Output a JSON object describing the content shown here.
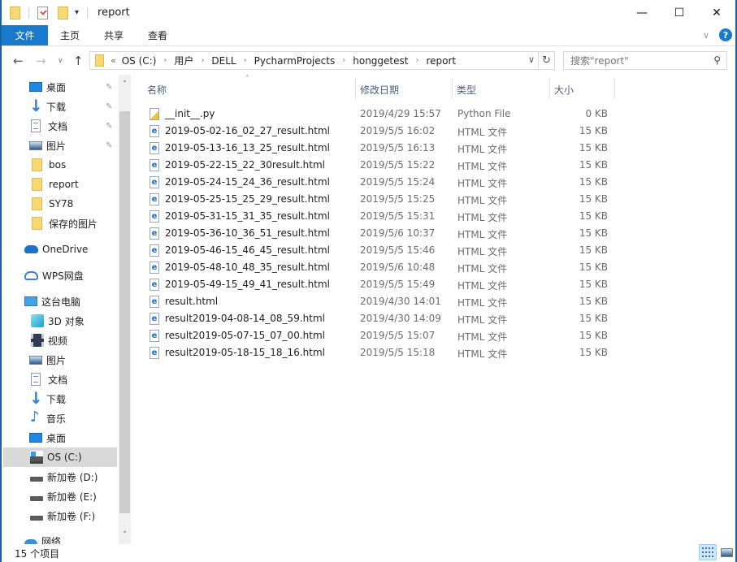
{
  "window": {
    "title": "report",
    "controls": {
      "minimize": "—",
      "maximize": "☐",
      "close": "✕"
    }
  },
  "ribbon": {
    "tabs": [
      {
        "label": "文件",
        "active": true
      },
      {
        "label": "主页"
      },
      {
        "label": "共享"
      },
      {
        "label": "查看"
      }
    ],
    "expand_icon": "∨",
    "help_icon": "?"
  },
  "nav": {
    "back": "←",
    "forward": "→",
    "recent": "∨",
    "up": "↑",
    "breadcrumb_lead": "«",
    "breadcrumb": [
      "OS (C:)",
      "用户",
      "DELL",
      "PycharmProjects",
      "honggetest",
      "report"
    ],
    "breadcrumb_sep": "›",
    "address_dropdown": "∨",
    "refresh": "↻",
    "search_placeholder": "搜索\"report\"",
    "search_icon": "⌕"
  },
  "sidebar": {
    "quick_access": [
      {
        "label": "桌面",
        "icon": "desktop",
        "pinned": true
      },
      {
        "label": "下载",
        "icon": "download",
        "pinned": true
      },
      {
        "label": "文档",
        "icon": "document",
        "pinned": true
      },
      {
        "label": "图片",
        "icon": "picture",
        "pinned": true
      },
      {
        "label": "bos",
        "icon": "folder"
      },
      {
        "label": "report",
        "icon": "folder"
      },
      {
        "label": "SY78",
        "icon": "folder"
      },
      {
        "label": "保存的图片",
        "icon": "folder"
      }
    ],
    "onedrive": "OneDrive",
    "wps": "WPS网盘",
    "this_pc": "这台电脑",
    "pc_items": [
      {
        "label": "3D 对象",
        "icon": "3d"
      },
      {
        "label": "视频",
        "icon": "video"
      },
      {
        "label": "图片",
        "icon": "picture"
      },
      {
        "label": "文档",
        "icon": "document"
      },
      {
        "label": "下载",
        "icon": "download"
      },
      {
        "label": "音乐",
        "icon": "music"
      },
      {
        "label": "桌面",
        "icon": "desktop"
      },
      {
        "label": "OS (C:)",
        "icon": "os-drive",
        "selected": true
      },
      {
        "label": "新加卷 (D:)",
        "icon": "drive"
      },
      {
        "label": "新加卷 (E:)",
        "icon": "drive"
      },
      {
        "label": "新加卷 (F:)",
        "icon": "drive"
      }
    ],
    "network": "网络",
    "pin_glyph": "📌",
    "scroll_up": "˄",
    "scroll_down": "˅"
  },
  "list": {
    "columns": {
      "name": "名称",
      "date": "修改日期",
      "type": "类型",
      "size": "大小"
    },
    "sort_indicator": "˄",
    "files": [
      {
        "name": "__init__.py",
        "date": "2019/4/29 15:57",
        "type": "Python File",
        "size": "0 KB",
        "icon": "py"
      },
      {
        "name": "2019-05-02-16_02_27_result.html",
        "date": "2019/5/5 16:02",
        "type": "HTML 文件",
        "size": "15 KB",
        "icon": "html"
      },
      {
        "name": "2019-05-13-16_13_25_result.html",
        "date": "2019/5/5 16:13",
        "type": "HTML 文件",
        "size": "15 KB",
        "icon": "html"
      },
      {
        "name": "2019-05-22-15_22_30result.html",
        "date": "2019/5/5 15:22",
        "type": "HTML 文件",
        "size": "15 KB",
        "icon": "html"
      },
      {
        "name": "2019-05-24-15_24_36_result.html",
        "date": "2019/5/5 15:24",
        "type": "HTML 文件",
        "size": "15 KB",
        "icon": "html"
      },
      {
        "name": "2019-05-25-15_25_29_result.html",
        "date": "2019/5/5 15:25",
        "type": "HTML 文件",
        "size": "15 KB",
        "icon": "html"
      },
      {
        "name": "2019-05-31-15_31_35_result.html",
        "date": "2019/5/5 15:31",
        "type": "HTML 文件",
        "size": "15 KB",
        "icon": "html"
      },
      {
        "name": "2019-05-36-10_36_51_result.html",
        "date": "2019/5/6 10:37",
        "type": "HTML 文件",
        "size": "15 KB",
        "icon": "html"
      },
      {
        "name": "2019-05-46-15_46_45_result.html",
        "date": "2019/5/5 15:46",
        "type": "HTML 文件",
        "size": "15 KB",
        "icon": "html"
      },
      {
        "name": "2019-05-48-10_48_35_result.html",
        "date": "2019/5/6 10:48",
        "type": "HTML 文件",
        "size": "15 KB",
        "icon": "html"
      },
      {
        "name": "2019-05-49-15_49_41_result.html",
        "date": "2019/5/5 15:49",
        "type": "HTML 文件",
        "size": "15 KB",
        "icon": "html"
      },
      {
        "name": "result.html",
        "date": "2019/4/30 14:01",
        "type": "HTML 文件",
        "size": "15 KB",
        "icon": "html"
      },
      {
        "name": "result2019-04-08-14_08_59.html",
        "date": "2019/4/30 14:09",
        "type": "HTML 文件",
        "size": "15 KB",
        "icon": "html"
      },
      {
        "name": "result2019-05-07-15_07_00.html",
        "date": "2019/5/5 15:07",
        "type": "HTML 文件",
        "size": "15 KB",
        "icon": "html"
      },
      {
        "name": "result2019-05-18-15_18_16.html",
        "date": "2019/5/5 15:18",
        "type": "HTML 文件",
        "size": "15 KB",
        "icon": "html"
      }
    ]
  },
  "status": {
    "item_count": "15 个项目"
  }
}
